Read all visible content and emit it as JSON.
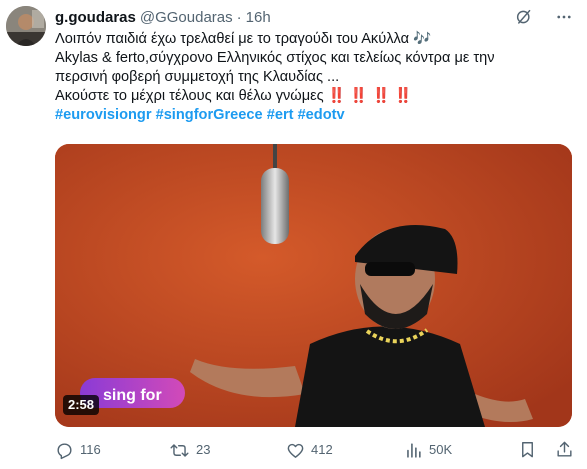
{
  "author": {
    "display_name": "g.goudaras",
    "handle": "@GGoudaras",
    "separator": "·",
    "time": "16h"
  },
  "text": {
    "line1": "Λοιπόν παιδιά έχω τρελαθεί με το τραγούδι του Ακύλλα 🎶",
    "line2": "Akylas & ferto,σύγχρονο Ελληνικός στίχος και τελείως κόντρα με την",
    "line3": "περσινή φοβερή συμμετοχή της Κλαυδίας ...",
    "line4": "Ακούστε το μέχρι τέλους και θέλω γνώμες ‼️ ‼️ ‼️ ‼️",
    "hashtags": [
      "#eurovisiongr",
      "#singforGreece",
      "#ert",
      "#edotv"
    ]
  },
  "video": {
    "duration": "2:58",
    "overlay_text": "sing for"
  },
  "actions": {
    "replies": "116",
    "retweets": "23",
    "likes": "412",
    "views": "50K"
  },
  "icons": {
    "grok": "grok-icon",
    "more": "more-icon",
    "reply": "reply-icon",
    "retweet": "retweet-icon",
    "like": "like-icon",
    "views": "views-icon",
    "bookmark": "bookmark-icon",
    "share": "share-icon"
  },
  "colors": {
    "text": "#0f1419",
    "muted": "#536471",
    "link": "#1d9bf0",
    "video_background": "#c2471f"
  }
}
